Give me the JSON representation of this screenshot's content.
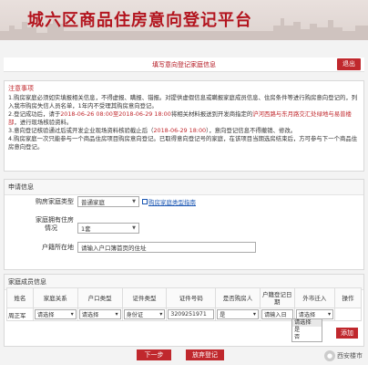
{
  "banner": {
    "title": "城六区商品住房意向登记平台"
  },
  "topbar": {
    "title": "填写意向登记家庭信息",
    "exit_label": "退出"
  },
  "notice": {
    "title": "注意事项",
    "items": [
      "1.购房家庭必须如实填报相关信息，不得虚报、瞒报、错报。对提供虚假信息或瞒报家庭成员信息、住房条件等进行购房意向登记的，列入我市购房失信人员名单，1年内不受理其购房意向登记。",
      "2.登记成功后，请于",
      "2018-06-26 08:00至2018-06-29 18:00",
      "将相关材料报送到开发商指定的",
      "沪河西路与东月路交汇处绿地与易普楼部",
      "，进行现场核验资料。",
      "3.意向登记核验通过后或开发企业现场资料核验截止后（",
      "2018-06-29 18:00",
      "），意向登记信息不得撤销、修改。",
      "4.购房家庭一次只能参与一个商品住房项目购房意向登记。已取得意向登记号的家庭，在该项目当期选房结束后，方可参与下一个商品住房意向登记。"
    ]
  },
  "apply": {
    "title": "申请信息",
    "family_type_label": "购房家庭类型",
    "family_type_value": "普通家庭",
    "family_type_guide": "购房家庭类型指南",
    "housing_label_1": "家庭拥有住房",
    "housing_label_2": "情况",
    "housing_value": "1套",
    "hukou_label": "户籍所在地",
    "hukou_placeholder": "请输入户口簿首页的住址"
  },
  "members": {
    "title": "家庭成员信息",
    "headers": [
      "姓名",
      "家庭关系",
      "户口类型",
      "证件类型",
      "证件号码",
      "是否购房人",
      "户籍登记日期",
      "外市迁入",
      "操作"
    ],
    "row": {
      "name": "周正军",
      "relation": "请选择",
      "hukou_type": "请选择",
      "id_type": "身份证",
      "id_no": "3209251971",
      "is_buyer": "是",
      "reg_date": "请输入日",
      "move_in": "请选择"
    },
    "dropdown_options": [
      "请选择",
      "是",
      "否"
    ],
    "add_label": "添加"
  },
  "footer": {
    "next_label": "下一步",
    "abandon_label": "放弃登记"
  },
  "watermark": {
    "text": "西安楼市"
  }
}
